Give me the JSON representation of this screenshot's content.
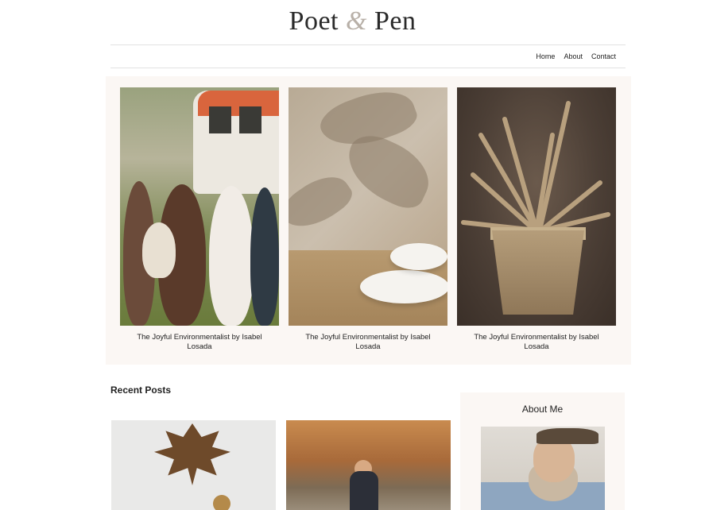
{
  "site": {
    "title_part1": "Poet",
    "title_amp": "&",
    "title_part2": "Pen"
  },
  "nav": {
    "items": [
      "Home",
      "About",
      "Contact"
    ]
  },
  "featured": {
    "cards": [
      {
        "caption": "The Joyful Environmentalist by Isabel Losada",
        "image": "friends-picnic-van-photo"
      },
      {
        "caption": "The Joyful Environmentalist by Isabel Losada",
        "image": "white-discs-shadow-photo"
      },
      {
        "caption": "The Joyful Environmentalist by Isabel Losada",
        "image": "cardboard-plant-photo"
      }
    ]
  },
  "recent": {
    "title": "Recent Posts",
    "posts": [
      {
        "image": "autumn-leaf-acorn-photo"
      },
      {
        "image": "girl-throwing-leaves-photo"
      }
    ]
  },
  "about": {
    "title": "About Me",
    "image": "bearded-man-hat-photo"
  },
  "colors": {
    "panel_bg": "#fbf7f4",
    "accent_amp": "#b8b0a8",
    "rule": "#e2e2e2"
  }
}
